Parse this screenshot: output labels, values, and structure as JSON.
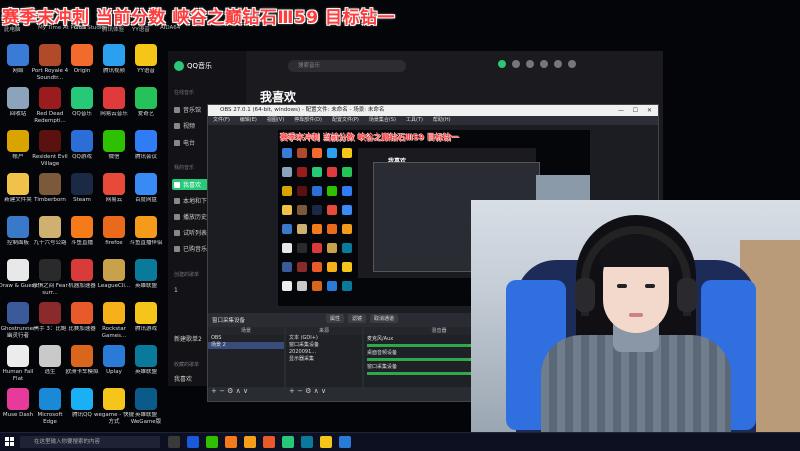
{
  "overlay": {
    "title": "赛季末冲刺 当前分数 峡谷之巅钻石Ⅲ59 目标钻一"
  },
  "desktop": {
    "top_labels": [
      "此电脑",
      "My Time At Portia",
      "OBS Studio",
      "腾讯体验",
      "YY语音",
      "AIDA64"
    ],
    "icons": [
      {
        "label": "网络",
        "color": "#3b7bd8"
      },
      {
        "label": "Port Royale 4 Soundtr...",
        "color": "#b04a2a"
      },
      {
        "label": "Origin",
        "color": "#f26a2c"
      },
      {
        "label": "腾讯视频",
        "color": "#2aa0ef"
      },
      {
        "label": "YY语音",
        "color": "#f5c518"
      },
      {
        "label": "回收站",
        "color": "#8da3bc"
      },
      {
        "label": "Red Dead Redempti...",
        "color": "#9b1c1c"
      },
      {
        "label": "QQ音乐",
        "color": "#27c878"
      },
      {
        "label": "网易云音乐",
        "color": "#e13a3a"
      },
      {
        "label": "爱奇艺",
        "color": "#25c25a"
      },
      {
        "label": "帐户",
        "color": "#d9a400"
      },
      {
        "label": "Resident Evil Village",
        "color": "#5c1111"
      },
      {
        "label": "QQ游戏",
        "color": "#2b6fd6"
      },
      {
        "label": "微信",
        "color": "#2dc100"
      },
      {
        "label": "腾讯会议",
        "color": "#2f7cf6"
      },
      {
        "label": "新建文件夹",
        "color": "#f0c24a"
      },
      {
        "label": "Timberborn",
        "color": "#7a5a3a"
      },
      {
        "label": "Steam",
        "color": "#1b2a44"
      },
      {
        "label": "网易云",
        "color": "#e84a3a"
      },
      {
        "label": "百度网盘",
        "color": "#3a8af5"
      },
      {
        "label": "控制面板",
        "color": "#3a78c8"
      },
      {
        "label": "九十六号公路",
        "color": "#d0b070"
      },
      {
        "label": "斗鱼直播",
        "color": "#f57a1a"
      },
      {
        "label": "firefox",
        "color": "#e86a1a"
      },
      {
        "label": "斗鱼直播伴侣",
        "color": "#f59a1a"
      },
      {
        "label": "Draw & Guess",
        "color": "#e8e8e8"
      },
      {
        "label": "恐惧之间 Fear surr...",
        "color": "#2a2a2a"
      },
      {
        "label": "机器加速器",
        "color": "#d93a3a"
      },
      {
        "label": "LeagueCli...",
        "color": "#c8a24a"
      },
      {
        "label": "英雄联盟",
        "color": "#0a7a9a"
      },
      {
        "label": "Ghostrunner 幽灵行者",
        "color": "#3a5a9a"
      },
      {
        "label": "黑手 3：比鲍",
        "color": "#8a2a2a"
      },
      {
        "label": "比赛加速器",
        "color": "#e85a2a"
      },
      {
        "label": "Rockstar Games...",
        "color": "#f5b01a"
      },
      {
        "label": "腾讯游戏",
        "color": "#f5c51a"
      },
      {
        "label": "Human Fall Flat",
        "color": "#ececec"
      },
      {
        "label": "逃生",
        "color": "#c9c9c9"
      },
      {
        "label": "欧洲卡车模拟",
        "color": "#d9661a"
      },
      {
        "label": "Uplay",
        "color": "#2a7ad8"
      },
      {
        "label": "英雄联盟",
        "color": "#0a7a9a"
      },
      {
        "label": "Muse Dash",
        "color": "#e83a9a"
      },
      {
        "label": "Microsoft Edge",
        "color": "#1a8ad8"
      },
      {
        "label": "腾讯QQ",
        "color": "#1ab0f5"
      },
      {
        "label": "wegame - 快捷方式",
        "color": "#f5c51a"
      },
      {
        "label": "英雄联盟 WeGame版",
        "color": "#0a5a8a"
      }
    ]
  },
  "qqmusic": {
    "app_name": "QQ音乐",
    "search_placeholder": "搜索音乐",
    "heading": "我喜欢",
    "sections": [
      "在线音乐",
      "我的音乐",
      "创建的歌单",
      "收藏的歌单"
    ],
    "nav_online": [
      "音乐馆",
      "视频",
      "电台"
    ],
    "nav_mine": [
      "我喜欢",
      "本地和下载",
      "播放历史",
      "试听列表",
      "已购音乐"
    ],
    "nav_playlists": [
      "1",
      "新建歌单2"
    ],
    "nav_fav": [
      "我喜欢"
    ]
  },
  "obs": {
    "title": "OBS 27.0.1 (64-bit, windows) - 配置文件: 未命名 - 场景: 未命名",
    "menu": [
      "文件(F)",
      "编辑(E)",
      "视图(V)",
      "停靠部件(D)",
      "配置文件(P)",
      "场景集合(S)",
      "工具(T)",
      "帮助(H)"
    ],
    "preview_title": "赛季末冲刺 当前分数 峡谷之巅钻石Ⅲ59 目标钻一",
    "preview_heading": "我喜欢",
    "source_label": "窗口采集设备",
    "buttons": [
      "属性",
      "滤镜",
      "取消通道"
    ],
    "docks": {
      "scenes": "场景",
      "sources": "来源",
      "mixer": "混音器"
    },
    "scenes": [
      "OBS",
      "场景 2"
    ],
    "sources": [
      "文本 (GDI+)",
      "窗口采集设备",
      "2020091...",
      "显示器采集"
    ],
    "mixer": [
      "麦克风/Aux",
      "桌面音频设备",
      "窗口采集设备"
    ],
    "tools": "+ − ⚙ ∧ ∨"
  },
  "taskbar": {
    "search_placeholder": "在这里输入你要搜索的内容",
    "apps": [
      "#3a3a3a",
      "#1a5ad8",
      "#2dc100",
      "#f57a1a",
      "#f5a01a",
      "#e85a2a",
      "#27c878",
      "#0a7a9a",
      "#f5c51a",
      "#2a7ad8"
    ]
  }
}
